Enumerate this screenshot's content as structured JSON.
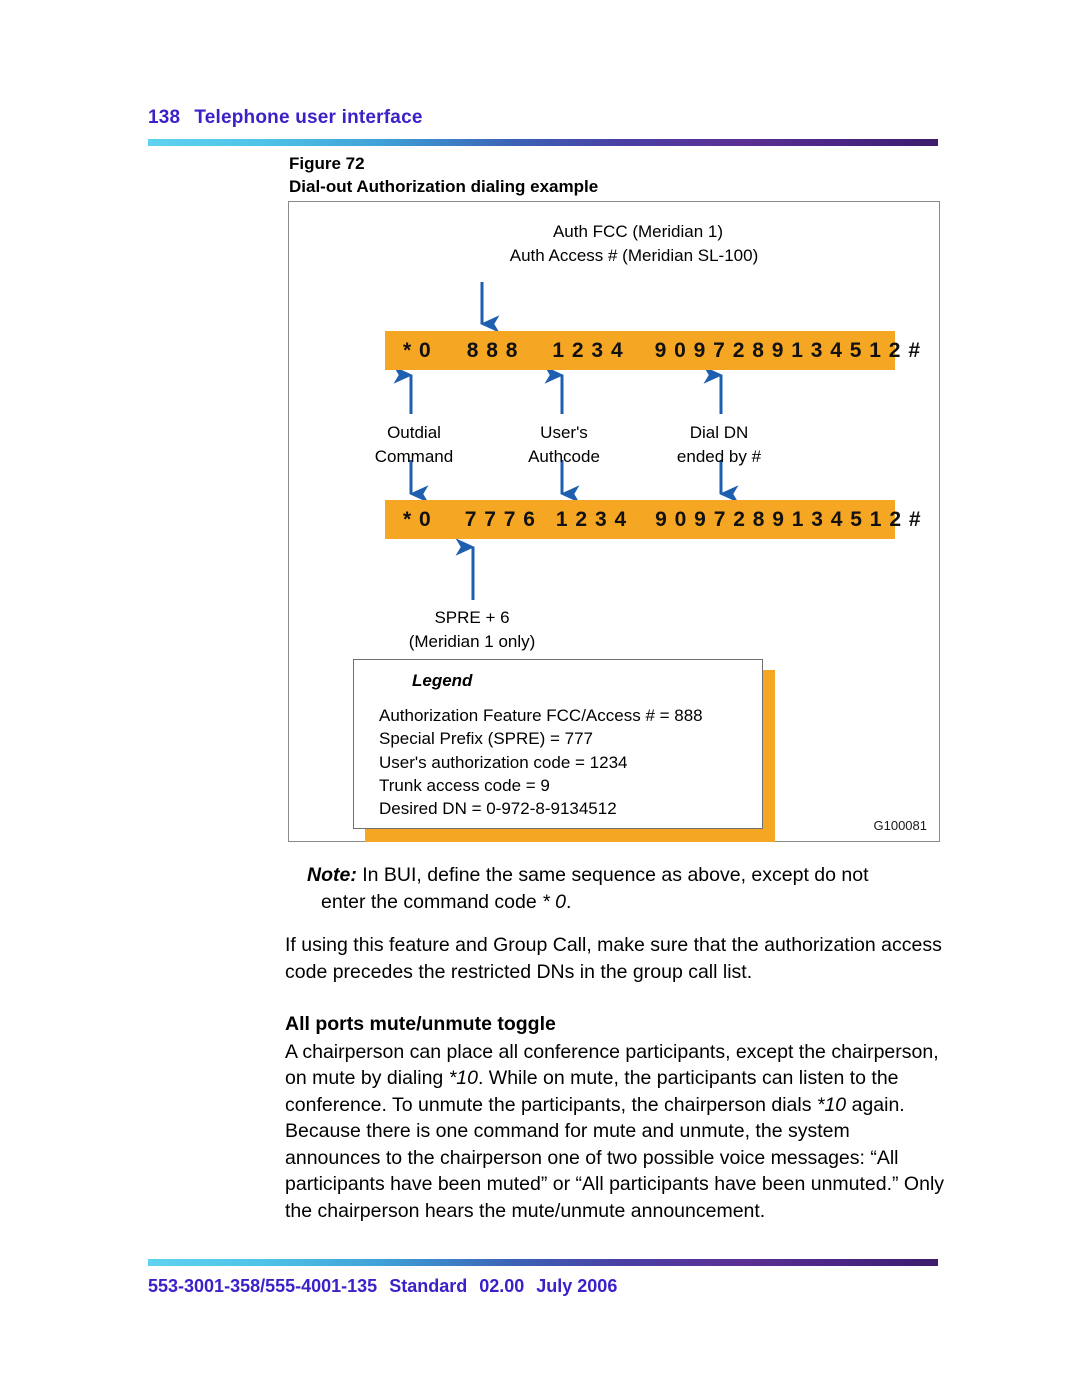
{
  "header": {
    "page_number": "138",
    "title": "Telephone user interface",
    "accent_color": "#3A22C8",
    "rule_gradient_from": "#5ED2EE",
    "rule_gradient_to": "#3C1C6E"
  },
  "figure": {
    "number_label": "Figure 72",
    "caption": "Dial-out Authorization dialing example",
    "figure_id": "G100081",
    "bar_color": "#F5A623",
    "arrow_color": "#1F5FB0",
    "top_callout": {
      "line1": "Auth FCC (Meridian 1)",
      "line2": "Auth Access # (Meridian SL-100)"
    },
    "bar_one": {
      "command": "* 0",
      "fcc": "8 8 8",
      "authcode": "1 2 3 4",
      "dn": "9 0 9 7 2 8 9 1 3 4 5 1 2 #"
    },
    "bar_two": {
      "command": "* 0",
      "spre": "7 7 7 6",
      "authcode": "1 2 3 4",
      "dn": "9 0 9 7 2 8 9 1 3 4 5 1 2 #"
    },
    "mid_labels": {
      "outdial_l1": "Outdial",
      "outdial_l2": "Command",
      "authcode_l1": "User's",
      "authcode_l2": "Authcode",
      "dialdn_l1": "Dial DN",
      "dialdn_l2": "ended by #"
    },
    "spre_label": {
      "line1": "SPRE + 6",
      "line2": "(Meridian 1 only)"
    },
    "legend": {
      "title": "Legend",
      "items": [
        "Authorization Feature FCC/Access # = 888",
        "Special Prefix (SPRE) = 777",
        "User's authorization code = 1234",
        "Trunk access code = 9",
        "Desired DN = 0-972-8-9134512"
      ]
    }
  },
  "body": {
    "note_lead": "Note:",
    "note_text_a": " In BUI, define the same sequence as above, except do not",
    "note_text_b": "enter the command code ",
    "note_code": "* 0",
    "note_text_c": ".",
    "paragraph_group_call": "If using this feature and Group Call, make sure that the authorization access code precedes the restricted DNs in the group call list.",
    "section_heading": "All ports mute/unmute toggle",
    "mute_part1": "A chairperson can place all conference participants, except the chairperson, on mute by dialing ",
    "mute_code1": "*10",
    "mute_part2": ". While on mute, the participants can listen to the conference. To unmute the participants, the chairperson dials ",
    "mute_code2": "*10",
    "mute_part3": " again. Because there is one command for mute and unmute, the system announces to the chairperson one of two possible voice messages: “All participants have been muted” or “All participants have been unmuted.” Only the chairperson hears the mute/unmute announcement."
  },
  "footer": {
    "doc_codes": "553-3001-358/555-4001-135",
    "standard": "Standard",
    "version": "02.00",
    "date": "July 2006",
    "accent_color": "#3A22C8"
  }
}
